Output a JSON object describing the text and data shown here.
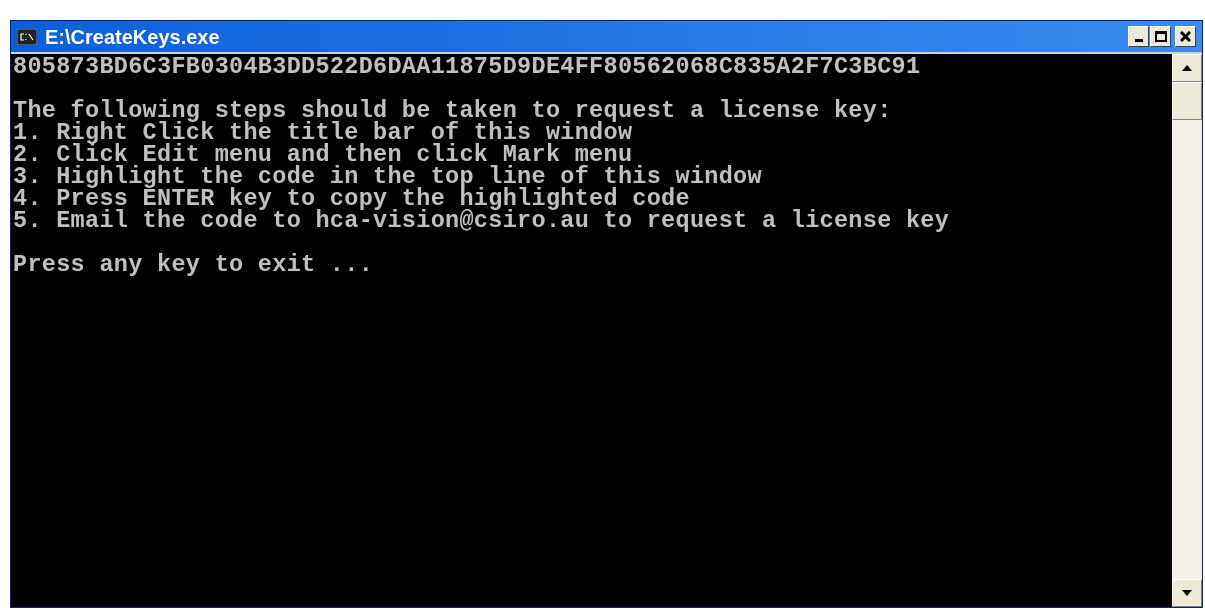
{
  "window": {
    "title": "E:\\CreateKeys.exe"
  },
  "console": {
    "code": "805873BD6C3FB0304B3DD522D6DAA11875D9DE4FF80562068C835A2F7C3BC91",
    "instructions": [
      "The following steps should be taken to request a license key:",
      "1. Right Click the title bar of this window",
      "2. Click Edit menu and then click Mark menu",
      "3. Highlight the code in the top line of this window",
      "4. Press ENTER key to copy the highlighted code",
      "5. Email the code to hca-vision@csiro.au to request a license key"
    ],
    "prompt": "Press any key to exit ..."
  }
}
